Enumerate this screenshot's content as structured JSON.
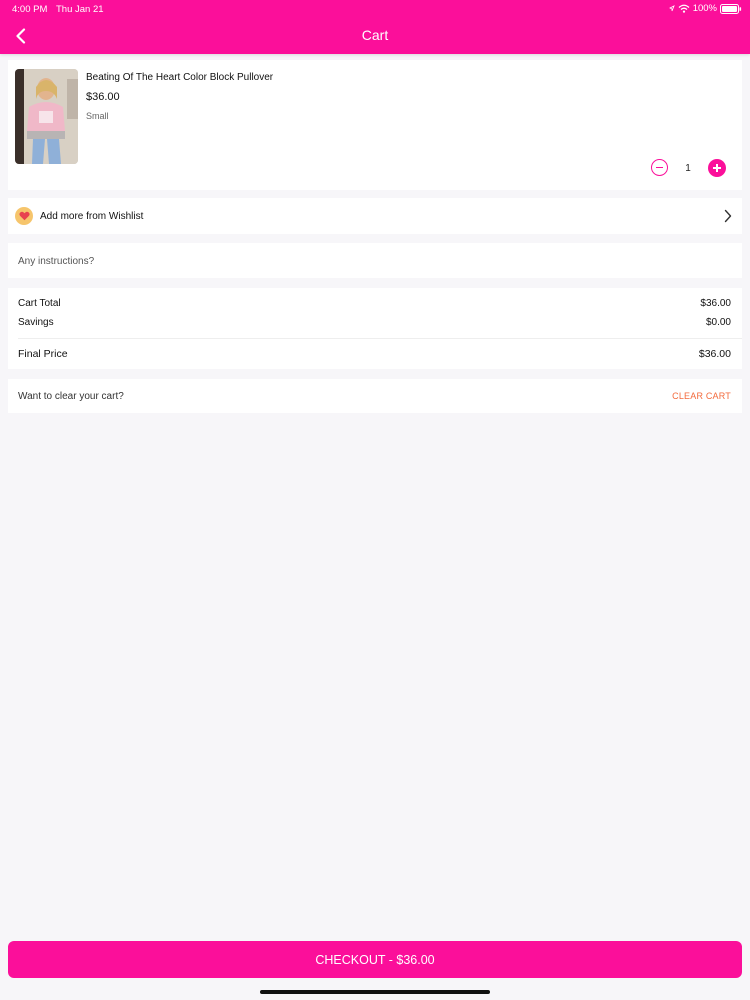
{
  "status_bar": {
    "time": "4:00 PM",
    "date": "Thu Jan 21",
    "battery": "100%"
  },
  "header": {
    "title": "Cart",
    "back_icon": "chevron-left-icon",
    "background_color": "#fb0f9a"
  },
  "cart_item": {
    "name": "Beating Of The Heart Color Block Pullover",
    "price": "$36.00",
    "size": "Small",
    "quantity": "1"
  },
  "wishlist": {
    "label": "Add more from Wishlist",
    "icon": "heart-icon"
  },
  "instructions": {
    "placeholder": "Any instructions?"
  },
  "totals": {
    "cart_total_label": "Cart Total",
    "cart_total_value": "$36.00",
    "savings_label": "Savings",
    "savings_value": "$0.00",
    "final_price_label": "Final Price",
    "final_price_value": "$36.00"
  },
  "clear_cart": {
    "prompt": "Want to clear your cart?",
    "button_label": "CLEAR CART",
    "color": "#f36a3c"
  },
  "checkout": {
    "label": "CHECKOUT - $36.00"
  }
}
